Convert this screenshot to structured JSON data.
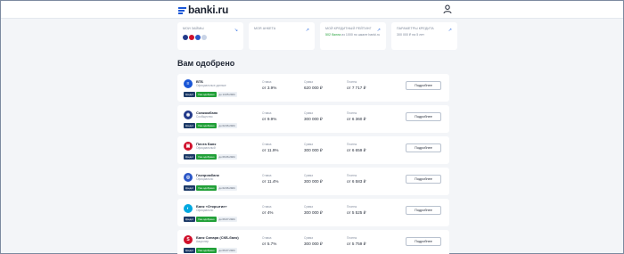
{
  "header": {
    "logo_text": "banki.ru",
    "user_icon": "user-icon"
  },
  "tiles": [
    {
      "title": "Мои займы",
      "sub": "",
      "arrow": "↘"
    },
    {
      "title": "Моя анкета",
      "sub": "",
      "arrow": "↗"
    },
    {
      "title": "Мой кредитный рейтинг",
      "sub_green": "502 балла",
      "sub": "из 1000 по шкале banki.ru",
      "arrow": "↗"
    },
    {
      "title": "Параметры кредита",
      "sub": "300 000 ₽ на 5 лет",
      "arrow": "↗"
    }
  ],
  "section_title": "Вам одобрено",
  "columns": {
    "rate": "Ставка",
    "sum": "Сумма",
    "pay": "Платеж"
  },
  "more_label": "Подробнее",
  "tags": {
    "credit": "Кредит",
    "approved": "Уже одобрено"
  },
  "offers": [
    {
      "bank": "ВТБ",
      "sub": "Официальные данные",
      "date": "до 14.05.2024",
      "rate": "от 3.9%",
      "sum": "620 000 ₽",
      "pay": "от 7 717 ₽",
      "logo_color": "#1a56d6",
      "logo_char": "≡"
    },
    {
      "bank": "Совкомбанк",
      "sub": "Сообщество",
      "date": "до 02.06.2024",
      "rate": "от 9.9%",
      "sum": "300 000 ₽",
      "pay": "от 6 360 ₽",
      "logo_color": "#233a8a",
      "logo_char": "◉"
    },
    {
      "bank": "Почта Банк",
      "sub": "Официальный",
      "date": "до 06.06.2024",
      "rate": "от 11.9%",
      "sum": "300 000 ₽",
      "pay": "от 6 659 ₽",
      "logo_color": "#d0102b",
      "logo_char": "▣"
    },
    {
      "bank": "Газпромбанк",
      "sub": "Официально",
      "date": "до 02.06.2024",
      "rate": "от 11.4%",
      "sum": "300 000 ₽",
      "pay": "от 6 583 ₽",
      "logo_color": "#2b57c7",
      "logo_char": "◎"
    },
    {
      "bank": "Банк «Открытие»",
      "sub": "Официально",
      "date": "до 06.07.2024",
      "rate": "от 4%",
      "sum": "300 000 ₽",
      "pay": "от 5 525 ₽",
      "logo_color": "#00a8e0",
      "logo_char": "◐"
    },
    {
      "bank": "Банк Синара (СКБ-банк)",
      "sub": "Акционер",
      "date": "до 06.07.2024",
      "rate": "от 5.7%",
      "sum": "300 000 ₽",
      "pay": "от 5 759 ₽",
      "logo_color": "#d0102b",
      "logo_char": "S"
    }
  ]
}
